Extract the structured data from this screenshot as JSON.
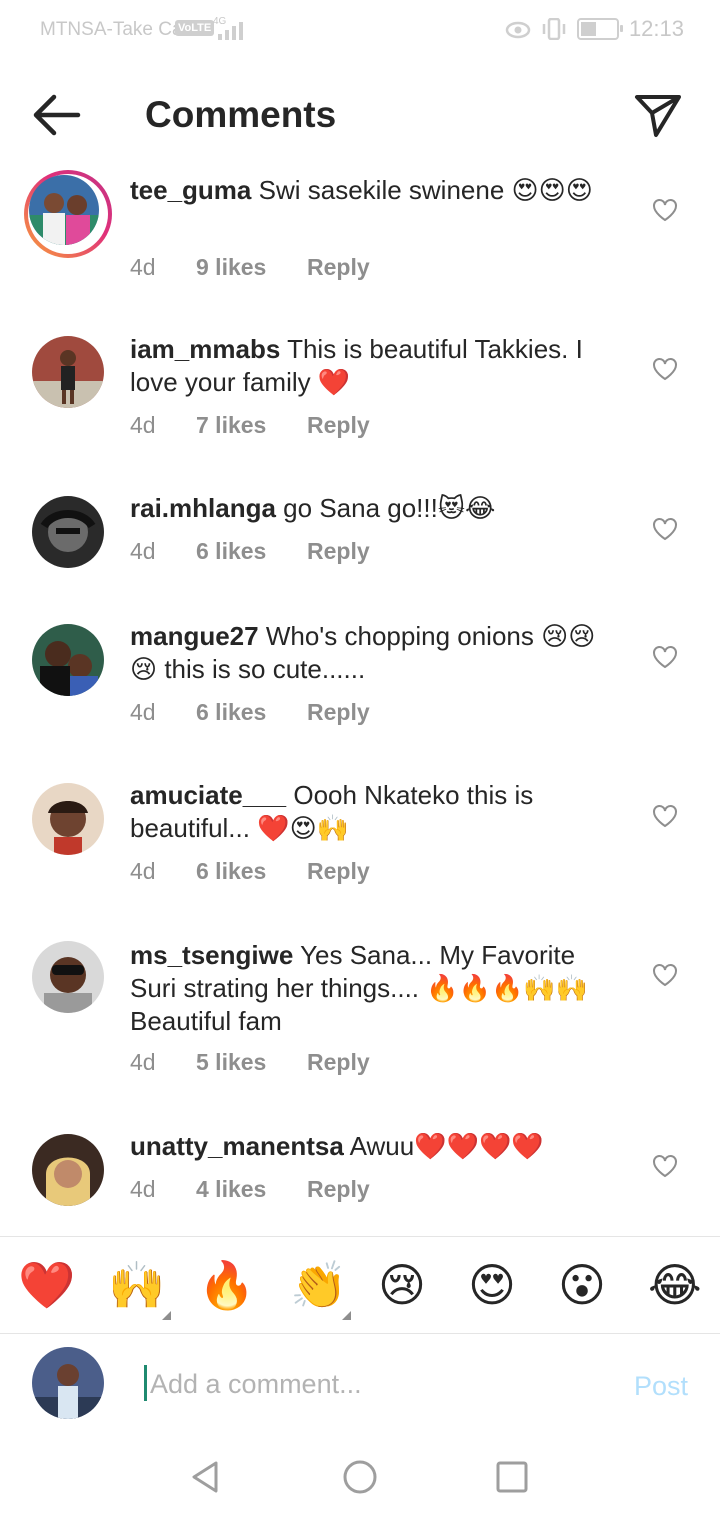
{
  "status": {
    "carrier": "MTNSA-Take Ca",
    "volte": "VoLTE",
    "network": "4G",
    "time": "12:13"
  },
  "header": {
    "title": "Comments"
  },
  "comments": [
    {
      "username": "tee_guma",
      "text": "Swi sasekile swinene",
      "emoji": "😍😍😍",
      "age": "4d",
      "likes": "9 likes",
      "reply": "Reply"
    },
    {
      "username": "iam_mmabs",
      "text": "This is beautiful Takkies. I love your family",
      "emoji": "❤️",
      "age": "4d",
      "likes": "7 likes",
      "reply": "Reply"
    },
    {
      "username": "rai.mhlanga",
      "text": "go Sana go!!!",
      "emoji": "😻😂",
      "age": "4d",
      "likes": "6 likes",
      "reply": "Reply"
    },
    {
      "username": "mangue27",
      "text": "Who's chopping  onions",
      "emoji": "😢😢😢",
      "text2": " this is  so cute......",
      "age": "4d",
      "likes": "6 likes",
      "reply": "Reply"
    },
    {
      "username": "amuciate___",
      "text": "Oooh Nkateko this is beautiful...",
      "emoji": "❤️😍🙌",
      "age": "4d",
      "likes": "6 likes",
      "reply": "Reply"
    },
    {
      "username": "ms_tsengiwe",
      "text": "Yes Sana... My Favorite Suri strating  her things....",
      "emoji": "🔥🔥🔥🙌🙌",
      "text2": " Beautiful fam",
      "age": "4d",
      "likes": "5 likes",
      "reply": "Reply"
    },
    {
      "username": "unatty_manentsa",
      "text": "Awuu",
      "emoji": "❤️❤️❤️❤️",
      "age": "4d",
      "likes": "4 likes",
      "reply": "Reply"
    }
  ],
  "quick_emojis": [
    "❤️",
    "🙌",
    "🔥",
    "👏",
    "😢",
    "😍",
    "😮",
    "😂"
  ],
  "composer": {
    "placeholder": "Add a comment...",
    "post": "Post"
  }
}
